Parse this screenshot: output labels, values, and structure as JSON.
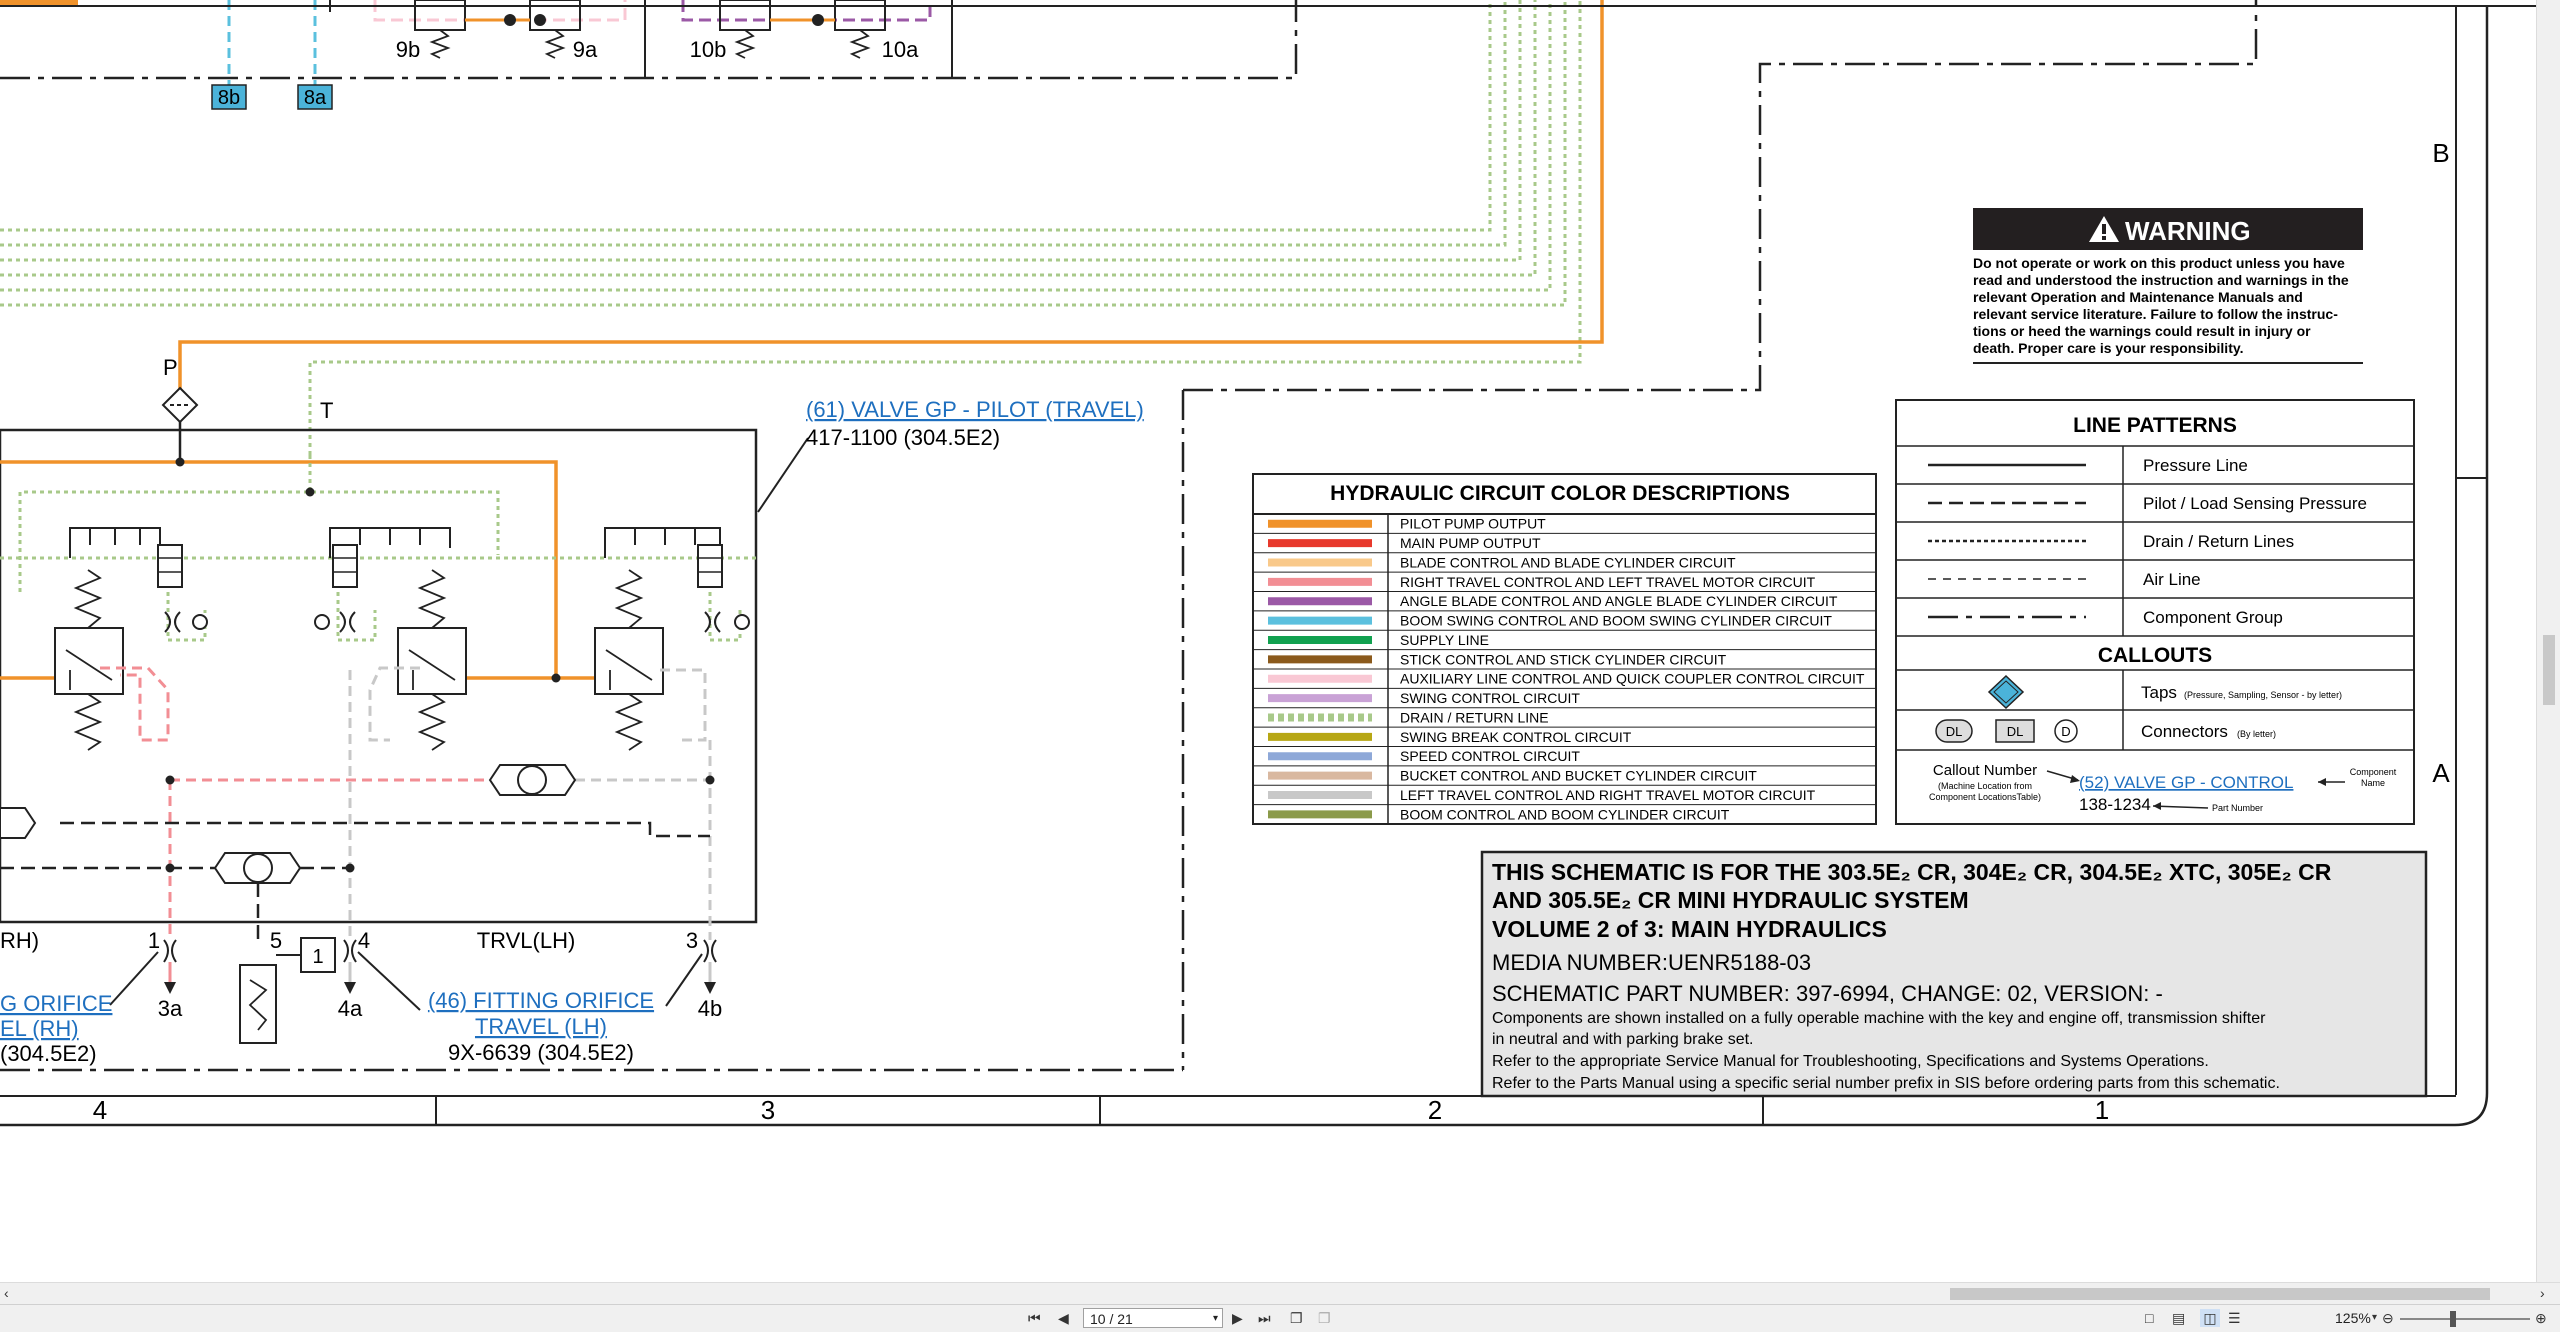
{
  "colors": {
    "pilot": "#f0922a",
    "main_pump": "#e8392c",
    "blade": "#f9c98a",
    "right_travel": "#f28e94",
    "angle_blade": "#9b59a6",
    "boom_swing": "#5bc0de",
    "supply": "#12a150",
    "stick": "#8b5a1c",
    "aux": "#f9c8d4",
    "swing_ctrl": "#c9a2d6",
    "drain": "#a8c98a",
    "swing_break": "#b7a714",
    "speed": "#8ea8d8",
    "bucket": "#d9b8a0",
    "left_travel": "#c8c8c8",
    "boom": "#8b9a4a",
    "link": "#1e6fbf",
    "tap_fill": "#4bb3d9"
  },
  "top_labels": {
    "v9b": "9b",
    "v9a": "9a",
    "v10b": "10b",
    "v10a": "10a",
    "tag8b": "8b",
    "tag8a": "8a"
  },
  "pilot_valve": {
    "port_p": "P",
    "port_t": "T",
    "title_link": "(61) VALVE GP -  PILOT (TRAVEL)",
    "part": "417-1100 (304.5E2)"
  },
  "bottom_labels": {
    "rh": "RH)",
    "n1": "1",
    "n5": "5",
    "box1": "1",
    "n4": "4",
    "trvl_lh": "TRVL(LH)",
    "n3": "3",
    "p3a": "3a",
    "p4a": "4a",
    "p4b": "4b",
    "orifice_left_1": "G ORIFICE",
    "orifice_left_2": "EL (RH)",
    "orifice_left_3": "(304.5E2)",
    "orifice_link_1": "(46) FITTING ORIFICE",
    "orifice_link_2": "TRAVEL (LH)",
    "orifice_part": "9X-6639 (304.5E2)"
  },
  "zones": {
    "z4": "4",
    "z3": "3",
    "z2": "2",
    "z1": "1",
    "row_b": "B",
    "row_a": "A"
  },
  "color_table": {
    "title": "HYDRAULIC CIRCUIT COLOR DESCRIPTIONS",
    "rows": [
      {
        "label": "PILOT PUMP OUTPUT",
        "color": "#f0922a",
        "dotted": false
      },
      {
        "label": "MAIN PUMP OUTPUT",
        "color": "#e8392c",
        "dotted": false
      },
      {
        "label": "BLADE CONTROL AND BLADE CYLINDER CIRCUIT",
        "color": "#f9c98a",
        "dotted": false
      },
      {
        "label": "RIGHT TRAVEL CONTROL AND LEFT TRAVEL MOTOR CIRCUIT",
        "color": "#f28e94",
        "dotted": false
      },
      {
        "label": "ANGLE BLADE CONTROL AND ANGLE BLADE CYLINDER CIRCUIT",
        "color": "#9b59a6",
        "dotted": false
      },
      {
        "label": "BOOM SWING CONTROL AND BOOM SWING CYLINDER CIRCUIT",
        "color": "#5bc0de",
        "dotted": false
      },
      {
        "label": "SUPPLY LINE",
        "color": "#12a150",
        "dotted": false
      },
      {
        "label": "STICK CONTROL AND STICK CYLINDER CIRCUIT",
        "color": "#8b5a1c",
        "dotted": false
      },
      {
        "label": "AUXILIARY LINE CONTROL AND QUICK COUPLER CONTROL CIRCUIT",
        "color": "#f9c8d4",
        "dotted": false
      },
      {
        "label": "SWING CONTROL CIRCUIT",
        "color": "#c9a2d6",
        "dotted": false
      },
      {
        "label": "DRAIN / RETURN LINE",
        "color": "#a8c98a",
        "dotted": true
      },
      {
        "label": "SWING BREAK CONTROL CIRCUIT",
        "color": "#b7a714",
        "dotted": false
      },
      {
        "label": "SPEED CONTROL CIRCUIT",
        "color": "#8ea8d8",
        "dotted": false
      },
      {
        "label": "BUCKET CONTROL AND BUCKET CYLINDER CIRCUIT",
        "color": "#d9b8a0",
        "dotted": false
      },
      {
        "label": "LEFT TRAVEL CONTROL AND RIGHT TRAVEL MOTOR CIRCUIT",
        "color": "#c8c8c8",
        "dotted": false
      },
      {
        "label": "BOOM CONTROL AND BOOM CYLINDER CIRCUIT",
        "color": "#8b9a4a",
        "dotted": false
      }
    ]
  },
  "warning": {
    "title": "WARNING",
    "lines": [
      "Do not operate or work on this product unless you have",
      "read and understood the instruction and warnings in the",
      "relevant  Operation  and  Maintenance  Manuals  and",
      "relevant service literature. Failure to follow the instruc-",
      "tions  or  heed  the  warnings  could  result  in  injury  or",
      "death. Proper care is your responsibility."
    ]
  },
  "line_patterns": {
    "title": "LINE PATTERNS",
    "rows": [
      {
        "label": "Pressure Line",
        "dash": ""
      },
      {
        "label": "Pilot / Load Sensing Pressure",
        "dash": "14,7"
      },
      {
        "label": "Drain / Return Lines",
        "dash": "4,3"
      },
      {
        "label": "Air Line",
        "dash": "8,7"
      },
      {
        "label": "Component Group",
        "dash": "30,8,6,8"
      }
    ],
    "callouts_title": "CALLOUTS",
    "taps_label": "Taps",
    "taps_note": "(Pressure, Sampling, Sensor - by letter)",
    "connectors_label": "Connectors",
    "connectors_note": "(By letter)",
    "dl_a": "DL",
    "dl_b": "DL",
    "dl_c": "D",
    "callout_number": "Callout Number",
    "callout_note_1": "(Machine Location from",
    "callout_note_2": "Component LocationsTable)",
    "callout_link": "(52) VALVE GP - CONTROL",
    "callout_part": "138-1234",
    "part_number_note": "Part Number",
    "component_note_1": "Component",
    "component_note_2": "Name"
  },
  "title_block": {
    "line1": "THIS SCHEMATIC IS FOR THE 303.5E₂ CR, 304E₂ CR, 304.5E₂ XTC, 305E₂ CR",
    "line2": "AND 305.5E₂ CR MINI HYDRAULIC SYSTEM",
    "line3": "VOLUME 2 of 3: MAIN HYDRAULICS",
    "media": "MEDIA NUMBER:UENR5188-03",
    "part": "SCHEMATIC PART NUMBER: 397-6994, CHANGE: 02, VERSION: -",
    "notes": [
      "Components are shown installed on a fully operable machine with the key and engine off, transmission shifter",
      "in neutral and with parking brake set.",
      "Refer to the appropriate Service Manual for Troubleshooting, Specifications and Systems Operations.",
      "Refer to the Parts Manual using a specific serial number prefix in SIS before ordering parts from this schematic."
    ]
  },
  "viewer": {
    "page_value": "10 / 21",
    "zoom": "125%"
  }
}
